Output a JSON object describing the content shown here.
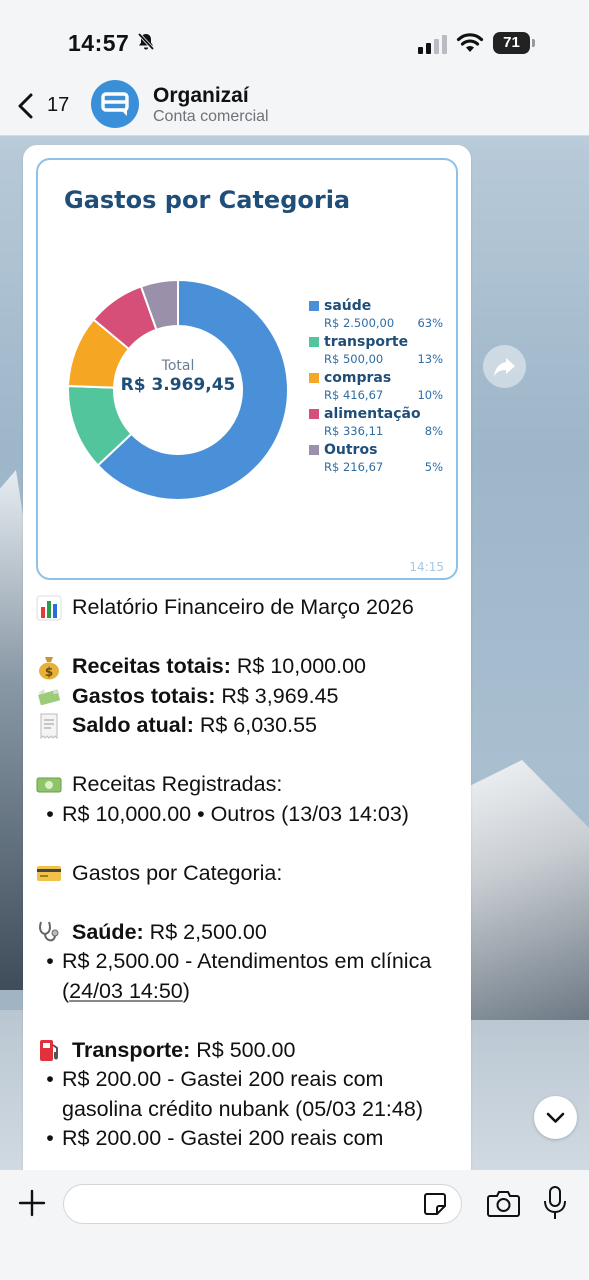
{
  "status_bar": {
    "time": "14:57",
    "battery": "71"
  },
  "header": {
    "back_count": "17",
    "contact_name": "Organizaí",
    "contact_subtitle": "Conta comercial"
  },
  "chart_data": {
    "type": "pie",
    "title": "Gastos por Categoria",
    "center_label": "Total",
    "center_value": "R$ 3.969,45",
    "slices": [
      {
        "name": "saúde",
        "amount_label": "R$ 2.500,00",
        "percent_label": "63%",
        "value": 2500.0,
        "color": "#4a90d9"
      },
      {
        "name": "transporte",
        "amount_label": "R$ 500,00",
        "percent_label": "13%",
        "value": 500.0,
        "color": "#52c59c"
      },
      {
        "name": "compras",
        "amount_label": "R$ 416,67",
        "percent_label": "10%",
        "value": 416.67,
        "color": "#f5a623"
      },
      {
        "name": "alimentação",
        "amount_label": "R$ 336,11",
        "percent_label": "8%",
        "value": 336.11,
        "color": "#d64f78"
      },
      {
        "name": "Outros",
        "amount_label": "R$ 216,67",
        "percent_label": "5%",
        "value": 216.67,
        "color": "#9b90aa"
      }
    ],
    "legend_position": "right",
    "timestamp": "14:15"
  },
  "message": {
    "report_title": "Relatório Financeiro de Março 2026",
    "income_label": "Receitas totais:",
    "income_value": " R$ 10,000.00",
    "expenses_label": "Gastos totais:",
    "expenses_value": " R$ 3,969.45",
    "balance_label": "Saldo atual:",
    "balance_value": " R$ 6,030.55",
    "registered_income_title": "Receitas Registradas:",
    "registered_income_items": [
      "R$ 10,000.00 • Outros (13/03 14:03)"
    ],
    "categories_title": "Gastos por Categoria:",
    "health_label": "Saúde:",
    "health_value": " R$ 2,500.00",
    "health_item_text": "R$ 2,500.00 - Atendimentos em clínica (",
    "health_item_date": "24/03 14:50",
    "health_item_close": ")",
    "transport_label": "Transporte:",
    "transport_value": " R$ 500.00",
    "transport_items": [
      "R$ 200.00 - Gastei 200 reais com gasolina crédito nubank (05/03 21:48)",
      "R$ 200.00 - Gastei 200 reais com"
    ]
  },
  "input": {
    "placeholder": "",
    "value": ""
  },
  "colors": {
    "title_blue": "#1f4e79",
    "header_bg": "#f3f5f7",
    "card_border": "#8ec1e9"
  }
}
